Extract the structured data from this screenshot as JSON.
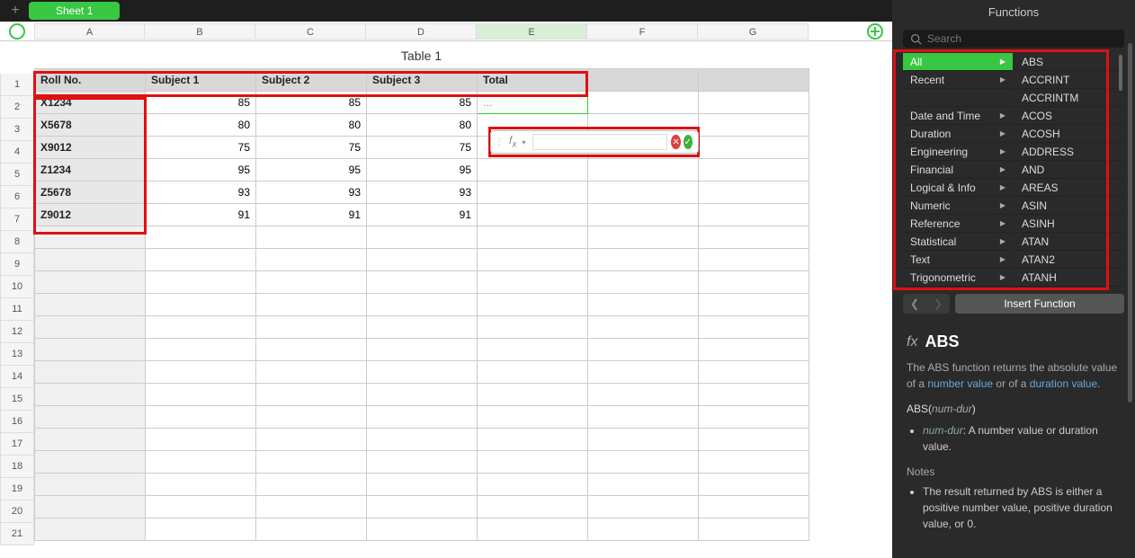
{
  "tabs": {
    "sheet_label": "Sheet 1"
  },
  "columns": [
    "A",
    "B",
    "C",
    "D",
    "E",
    "F",
    "G"
  ],
  "selected_col_index": 4,
  "table": {
    "title": "Table 1",
    "headers": [
      "Roll No.",
      "Subject 1",
      "Subject 2",
      "Subject 3",
      "Total"
    ],
    "rows": [
      {
        "roll": "X1234",
        "s1": 85,
        "s2": 85,
        "s3": 85
      },
      {
        "roll": "X5678",
        "s1": 80,
        "s2": 80,
        "s3": 80
      },
      {
        "roll": "X9012",
        "s1": 75,
        "s2": 75,
        "s3": 75
      },
      {
        "roll": "Z1234",
        "s1": 95,
        "s2": 95,
        "s3": 95
      },
      {
        "roll": "Z5678",
        "s1": 93,
        "s2": 93,
        "s3": 93
      },
      {
        "roll": "Z9012",
        "s1": 91,
        "s2": 91,
        "s3": 91
      }
    ],
    "selected_cell_display": "…"
  },
  "row_numbers": [
    1,
    2,
    3,
    4,
    5,
    6,
    7,
    8,
    9,
    10,
    11,
    12,
    13,
    14,
    15,
    16,
    17,
    18,
    19,
    20,
    21
  ],
  "formula_input": "",
  "sidebar": {
    "title": "Functions",
    "search_placeholder": "Search",
    "categories": [
      "All",
      "Recent",
      "",
      "Date and Time",
      "Duration",
      "Engineering",
      "Financial",
      "Logical & Info",
      "Numeric",
      "Reference",
      "Statistical",
      "Text",
      "Trigonometric"
    ],
    "active_category_index": 0,
    "functions": [
      "ABS",
      "ACCRINT",
      "ACCRINTM",
      "ACOS",
      "ACOSH",
      "ADDRESS",
      "AND",
      "AREAS",
      "ASIN",
      "ASINH",
      "ATAN",
      "ATAN2",
      "ATANH"
    ],
    "insert_label": "Insert Function",
    "detail": {
      "name": "ABS",
      "description_pre": "The ABS function returns the absolute value of a ",
      "description_link1": "number value",
      "description_mid": " or of a ",
      "description_link2": "duration value",
      "description_post": ".",
      "signature_pre": "ABS(",
      "signature_param": "num-dur",
      "signature_post": ")",
      "param_name": "num-dur",
      "param_desc": ": A number value or duration value.",
      "notes_title": "Notes",
      "note1": "The result returned by ABS is either a positive number value, positive duration value, or 0."
    }
  }
}
